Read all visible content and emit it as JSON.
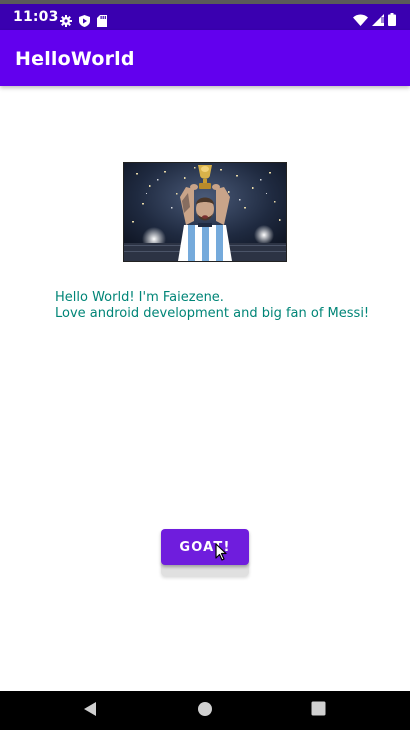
{
  "status_bar": {
    "time": "11:03",
    "left_icons": [
      "settings-gear-icon",
      "shield-icon",
      "sd-card-icon"
    ],
    "right_icons": [
      "wifi-icon",
      "cellular-signal-icon",
      "battery-icon"
    ]
  },
  "app_bar": {
    "title": "HelloWorld"
  },
  "hero_image": {
    "alt": "Soccer player lifting a trophy amid confetti"
  },
  "intro": {
    "line1": "Hello World! I'm Faiezene.",
    "line2": "Love android development and big fan of Messi!"
  },
  "goat_button": {
    "label": "GOAT!"
  },
  "nav_bar": {
    "buttons": [
      "back-icon",
      "home-icon",
      "recents-icon"
    ]
  },
  "colors": {
    "status_bar": "#3a00b0",
    "app_bar": "#6200ee",
    "accent_text": "#008577",
    "button": "#6f1ddd"
  }
}
